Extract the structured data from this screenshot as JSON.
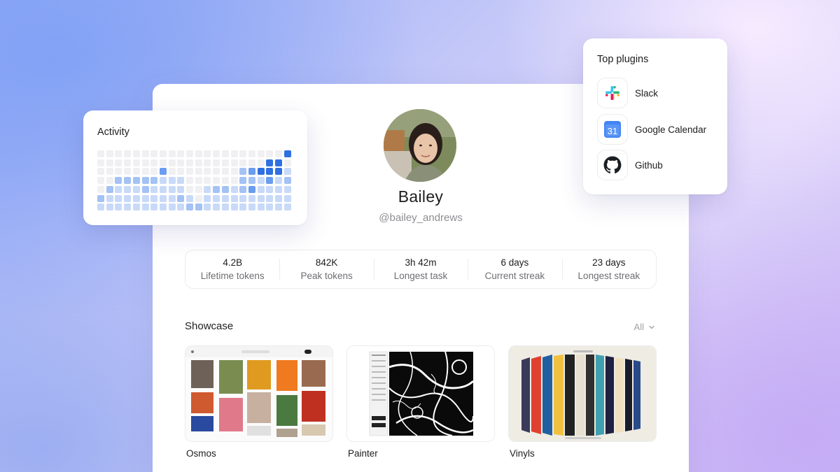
{
  "profile": {
    "name": "Bailey",
    "handle": "@bailey_andrews"
  },
  "stats": [
    {
      "value": "4.2B",
      "label": "Lifetime tokens"
    },
    {
      "value": "842K",
      "label": "Peak tokens"
    },
    {
      "value": "3h 42m",
      "label": "Longest task"
    },
    {
      "value": "6 days",
      "label": "Current streak"
    },
    {
      "value": "23 days",
      "label": "Longest streak"
    }
  ],
  "showcase": {
    "title": "Showcase",
    "filter_label": "All",
    "items": [
      {
        "label": "Osmos"
      },
      {
        "label": "Painter"
      },
      {
        "label": "Vinyls"
      }
    ]
  },
  "activity": {
    "title": "Activity",
    "levels": [
      [
        0,
        0,
        0,
        0,
        0,
        0,
        0,
        0,
        0,
        0,
        0,
        0,
        0,
        0,
        0,
        0,
        0,
        0,
        0,
        0,
        0,
        4
      ],
      [
        0,
        0,
        0,
        0,
        0,
        0,
        0,
        0,
        0,
        0,
        0,
        0,
        0,
        0,
        0,
        0,
        0,
        0,
        0,
        4,
        4,
        0
      ],
      [
        0,
        0,
        0,
        0,
        0,
        0,
        0,
        3,
        0,
        0,
        0,
        0,
        0,
        0,
        0,
        0,
        2,
        3,
        4,
        4,
        4,
        1
      ],
      [
        0,
        0,
        2,
        2,
        2,
        2,
        2,
        1,
        1,
        1,
        0,
        0,
        0,
        0,
        0,
        0,
        2,
        2,
        1,
        3,
        1,
        2
      ],
      [
        0,
        2,
        1,
        1,
        1,
        2,
        1,
        1,
        1,
        1,
        0,
        0,
        1,
        2,
        2,
        1,
        2,
        3,
        1,
        1,
        1,
        1
      ],
      [
        2,
        1,
        1,
        1,
        1,
        1,
        1,
        1,
        1,
        2,
        1,
        0,
        1,
        1,
        1,
        1,
        1,
        1,
        1,
        1,
        1,
        1
      ],
      [
        1,
        1,
        1,
        1,
        1,
        1,
        1,
        1,
        1,
        1,
        2,
        2,
        1,
        1,
        1,
        1,
        1,
        1,
        1,
        1,
        1,
        1
      ]
    ],
    "colors": [
      "#f0f0f2",
      "#c9daf8",
      "#a4c2f4",
      "#6a9cf0",
      "#2f6fe0"
    ]
  },
  "plugins": {
    "title": "Top plugins",
    "items": [
      {
        "name": "Slack",
        "icon": "slack-icon"
      },
      {
        "name": "Google Calendar",
        "icon": "google-calendar-icon",
        "badge": "31"
      },
      {
        "name": "Github",
        "icon": "github-icon"
      }
    ]
  }
}
